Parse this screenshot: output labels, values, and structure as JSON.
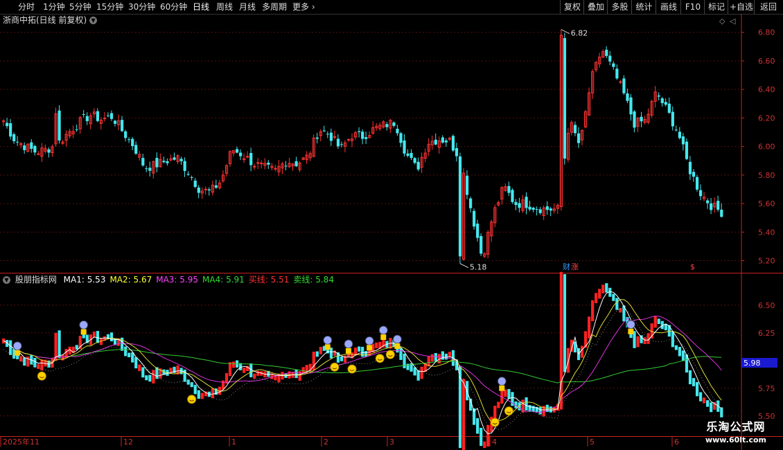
{
  "toolbar": {
    "periods": [
      "分时",
      "1分钟",
      "5分钟",
      "15分钟",
      "30分钟",
      "60分钟",
      "日线",
      "周线",
      "月线",
      "多周期",
      "更多"
    ],
    "active_period": "日线",
    "right_buttons": [
      "复权",
      "叠加",
      "多股",
      "统计",
      "画线",
      "F10",
      "标记",
      "+自选",
      "返回"
    ]
  },
  "main_title": "浙商中拓(日线 前复权)",
  "indicator": {
    "name": "股朋指标网",
    "ma": [
      {
        "label": "MA1:",
        "value": "5.53",
        "color": "#ffffff"
      },
      {
        "label": "MA2:",
        "value": "5.67",
        "color": "#ffff33"
      },
      {
        "label": "MA3:",
        "value": "5.95",
        "color": "#ff44ff"
      },
      {
        "label": "MA4:",
        "value": "5.91",
        "color": "#33dd33"
      },
      {
        "label": "买线:",
        "value": "5.51",
        "color": "#ff3333"
      },
      {
        "label": "卖线:",
        "value": "5.84",
        "color": "#33dd33"
      }
    ],
    "current_tag": "5.98"
  },
  "chart_data": [
    {
      "type": "candlestick",
      "title": "浙商中拓(日线 前复权)",
      "ylim": [
        5.12,
        6.92
      ],
      "y_ticks": [
        "6.80",
        "6.60",
        "6.40",
        "6.20",
        "6.00",
        "5.80",
        "5.60",
        "5.40",
        "5.20"
      ],
      "annotations": [
        {
          "text": "6.82",
          "type": "high",
          "value": 6.82
        },
        {
          "text": "5.18",
          "type": "low",
          "value": 5.18
        }
      ],
      "event_labels": [
        {
          "text": "财",
          "color": "#3399ff"
        },
        {
          "text": "涨",
          "color": "#ff4444"
        },
        {
          "text": "$",
          "color": "#ff4444"
        }
      ],
      "anchors": [
        6.18,
        6.05,
        6.0,
        5.96,
        5.98,
        6.02,
        6.1,
        6.17,
        6.22,
        6.19,
        6.21,
        6.1,
        6.0,
        5.85,
        5.87,
        5.9,
        5.92,
        5.82,
        5.7,
        5.68,
        5.76,
        5.98,
        5.94,
        5.88,
        5.85,
        5.83,
        5.9,
        5.88,
        5.93,
        6.12,
        6.08,
        5.98,
        6.08,
        6.07,
        6.12,
        6.15,
        6.17,
        5.95,
        5.84,
        6.03,
        6.05,
        6.04,
        5.91,
        5.55,
        5.22,
        5.52,
        5.72,
        5.6,
        5.6,
        5.57,
        5.56,
        5.56,
        6.18,
        6.0,
        6.46,
        6.68,
        6.54,
        6.37,
        6.16,
        6.18,
        6.38,
        6.25,
        6.1,
        5.85,
        5.68,
        5.59,
        5.54
      ]
    },
    {
      "type": "indicator",
      "title": "股朋指标网",
      "ylim": [
        5.33,
        6.78
      ],
      "y_ticks": [
        "6.50",
        "6.25",
        "5.75",
        "5.50"
      ],
      "x_labels": [
        "2025年11",
        "12",
        "1",
        "2",
        "3",
        "4",
        "5",
        "6"
      ],
      "series": [
        {
          "name": "MA1",
          "value": 5.53
        },
        {
          "name": "MA2",
          "value": 5.67
        },
        {
          "name": "MA3",
          "value": 5.95
        },
        {
          "name": "MA4",
          "value": 5.91
        },
        {
          "name": "买线",
          "value": 5.51
        },
        {
          "name": "卖线",
          "value": 5.84
        }
      ]
    }
  ],
  "watermark": {
    "title": "乐淘公式网",
    "url": "www.60lt.com"
  }
}
